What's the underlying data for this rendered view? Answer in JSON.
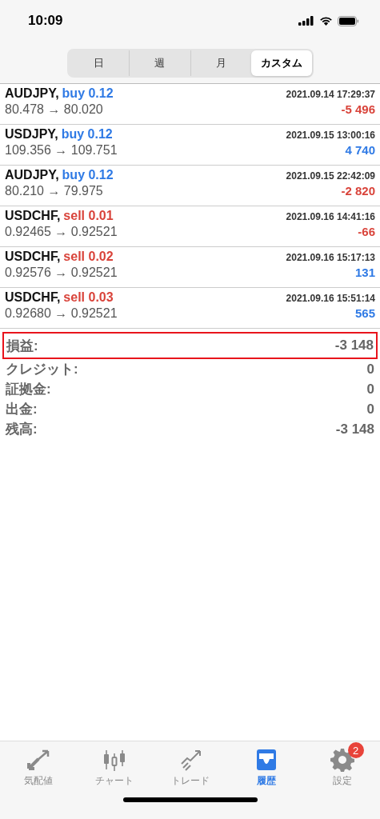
{
  "status_bar": {
    "time": "10:09"
  },
  "period_tabs": [
    {
      "label": "日",
      "selected": false
    },
    {
      "label": "週",
      "selected": false
    },
    {
      "label": "月",
      "selected": false
    },
    {
      "label": "カスタム",
      "selected": true
    }
  ],
  "trades": [
    {
      "symbol": "AUDJPY,",
      "kind": "buy",
      "volume": "buy 0.12",
      "time": "2021.09.14 17:29:37",
      "prices": "80.478 → 80.020",
      "profit": "-5 496",
      "loss": true
    },
    {
      "symbol": "USDJPY,",
      "kind": "buy",
      "volume": "buy 0.12",
      "time": "2021.09.15 13:00:16",
      "prices": "109.356 → 109.751",
      "profit": "4 740",
      "loss": false
    },
    {
      "symbol": "AUDJPY,",
      "kind": "buy",
      "volume": "buy 0.12",
      "time": "2021.09.15 22:42:09",
      "prices": "80.210 → 79.975",
      "profit": "-2 820",
      "loss": true
    },
    {
      "symbol": "USDCHF,",
      "kind": "sell",
      "volume": "sell 0.01",
      "time": "2021.09.16 14:41:16",
      "prices": "0.92465 → 0.92521",
      "profit": "-66",
      "loss": true
    },
    {
      "symbol": "USDCHF,",
      "kind": "sell",
      "volume": "sell 0.02",
      "time": "2021.09.16 15:17:13",
      "prices": "0.92576 → 0.92521",
      "profit": "131",
      "loss": false
    },
    {
      "symbol": "USDCHF,",
      "kind": "sell",
      "volume": "sell 0.03",
      "time": "2021.09.16 15:51:14",
      "prices": "0.92680 → 0.92521",
      "profit": "565",
      "loss": false
    }
  ],
  "summary": [
    {
      "label": "損益:",
      "value": "-3 148",
      "highlighted": true
    },
    {
      "label": "クレジット:",
      "value": "0",
      "highlighted": false
    },
    {
      "label": "証拠金:",
      "value": "0",
      "highlighted": false
    },
    {
      "label": "出金:",
      "value": "0",
      "highlighted": false
    },
    {
      "label": "残高:",
      "value": "-3 148",
      "highlighted": false
    }
  ],
  "tab_bar": [
    {
      "label": "気配値",
      "kind": "quotes",
      "selected": false
    },
    {
      "label": "チャート",
      "kind": "chart",
      "selected": false
    },
    {
      "label": "トレード",
      "kind": "trade",
      "selected": false
    },
    {
      "label": "履歴",
      "kind": "history",
      "selected": true
    },
    {
      "label": "設定",
      "kind": "settings",
      "selected": false,
      "badge": "2"
    }
  ]
}
